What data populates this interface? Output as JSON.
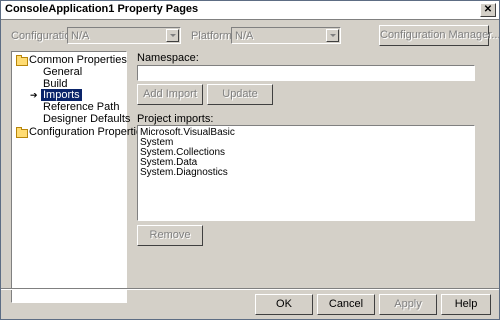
{
  "window": {
    "title": "ConsoleApplication1 Property Pages"
  },
  "config": {
    "configuration_label": "Configuration:",
    "configuration_value": "N/A",
    "platform_label": "Platform:",
    "platform_value": "N/A",
    "config_manager_label": "Configuration Manager..."
  },
  "tree": {
    "root1": "Common Properties",
    "children": [
      "General",
      "Build",
      "Imports",
      "Reference Path",
      "Designer Defaults"
    ],
    "root2": "Configuration Properties"
  },
  "imports": {
    "namespace_label": "Namespace:",
    "namespace_value": "",
    "add_import_label": "Add Import",
    "update_label": "Update",
    "project_imports_label": "Project imports:",
    "items": [
      "Microsoft.VisualBasic",
      "System",
      "System.Collections",
      "System.Data",
      "System.Diagnostics"
    ],
    "remove_label": "Remove"
  },
  "footer": {
    "ok": "OK",
    "cancel": "Cancel",
    "apply": "Apply",
    "help": "Help"
  }
}
